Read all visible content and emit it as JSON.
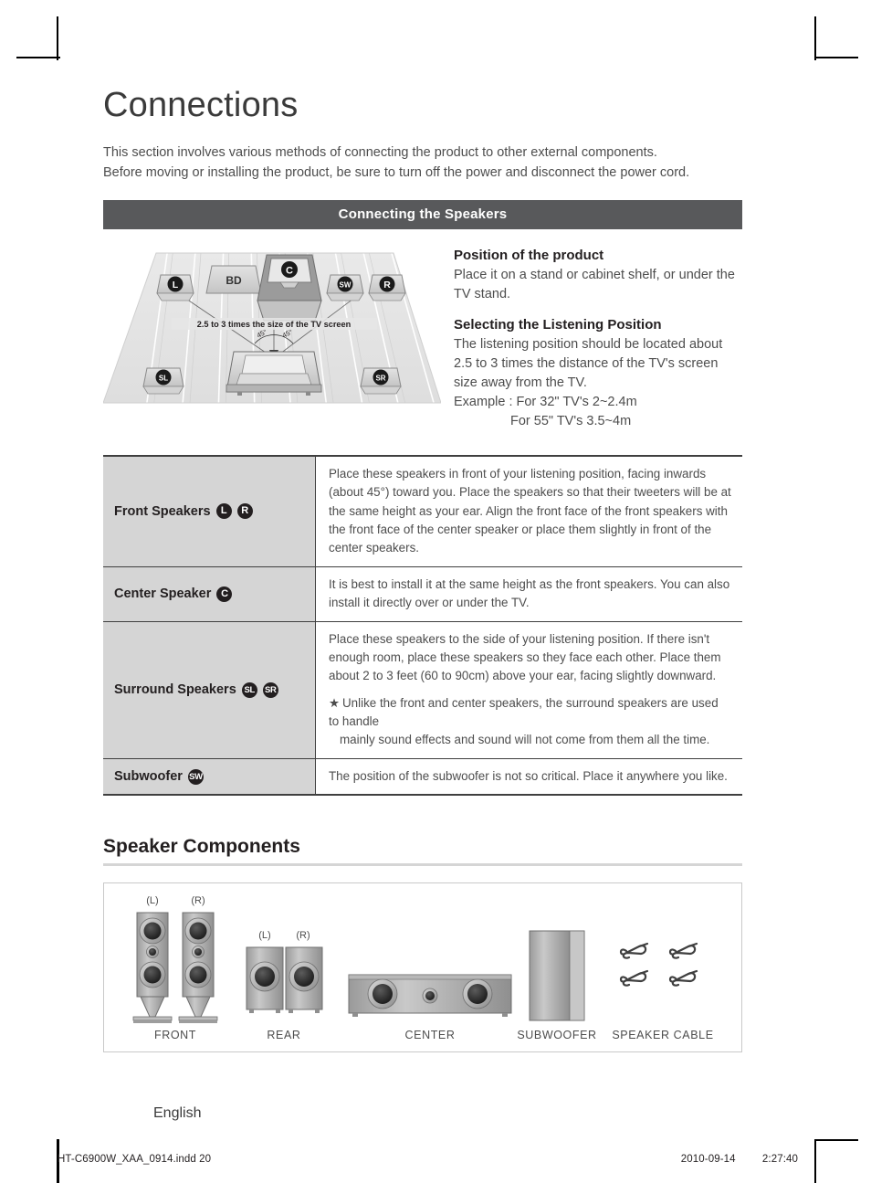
{
  "page": {
    "title": "Connections",
    "intro_line1": "This section involves various methods of connecting the product to other external components.",
    "intro_line2": "Before moving or installing the product, be sure to turn off the power and disconnect the power cord.",
    "section_bar": "Connecting the Speakers",
    "language_label": "English"
  },
  "diagram": {
    "caption": "2.5 to 3 times the size of the TV screen",
    "angle_left": "45°",
    "angle_right": "45°",
    "labels": {
      "left": "L",
      "bd": "BD",
      "center": "C",
      "subwoofer": "SW",
      "right": "R",
      "surround_left": "SL",
      "surround_right": "SR"
    }
  },
  "position_info": {
    "heading1": "Position of the product",
    "body1": "Place it on a stand or cabinet shelf, or under the TV stand.",
    "heading2": "Selecting the Listening Position",
    "body2": "The listening position should be located about 2.5 to 3 times the distance of the TV's screen size away from the TV.",
    "example_label": "Example : For 32\" TV's 2~2.4m",
    "example_line2": "For 55\" TV's 3.5~4m"
  },
  "spec_table": {
    "rows": [
      {
        "label": "Front Speakers",
        "badges": [
          "L",
          "R"
        ],
        "description": "Place these speakers in front of your listening position, facing inwards (about 45°) toward you. Place the speakers so that their tweeters will be at the same height as your ear. Align the front face of the front speakers with the front face of the center speaker or place them slightly in front of the center speakers.",
        "note": null,
        "note_cont": null
      },
      {
        "label": "Center Speaker",
        "badges": [
          "C"
        ],
        "description": "It is best to install it at the same height as the front speakers. You can also install it directly over or under the TV.",
        "note": null,
        "note_cont": null
      },
      {
        "label": "Surround Speakers",
        "badges": [
          "SL",
          "SR"
        ],
        "description": "Place these speakers to the side of your listening position. If there isn't enough room, place these speakers so they face each other. Place them about 2 to 3 feet (60 to 90cm) above your ear, facing slightly downward.",
        "note": "Unlike the front and center speakers, the surround speakers are used to handle",
        "note_cont": "mainly sound effects and sound will not come from them all the time."
      },
      {
        "label": "Subwoofer",
        "badges": [
          "SW"
        ],
        "description": "The position of the subwoofer is not so critical. Place it anywhere you like.",
        "note": null,
        "note_cont": null
      }
    ],
    "note_star": "★"
  },
  "speaker_components": {
    "heading": "Speaker Components",
    "items": [
      {
        "caption": "FRONT",
        "sub_left": "(L)",
        "sub_right": "(R)"
      },
      {
        "caption": "REAR",
        "sub_left": "(L)",
        "sub_right": "(R)"
      },
      {
        "caption": "CENTER",
        "sub_left": null,
        "sub_right": null
      },
      {
        "caption": "SUBWOOFER",
        "sub_left": null,
        "sub_right": null
      },
      {
        "caption": "SPEAKER CABLE",
        "sub_left": null,
        "sub_right": null
      }
    ]
  },
  "footer": {
    "file_name": "HT-C6900W_XAA_0914.indd   20",
    "date": "2010-09-14",
    "time": "2:27:40"
  },
  "colors": {
    "section_bar_bg": "#58595b",
    "table_label_bg": "#d5d5d5",
    "rule": "#3f3f3f",
    "body_text": "#4d4d4d"
  }
}
